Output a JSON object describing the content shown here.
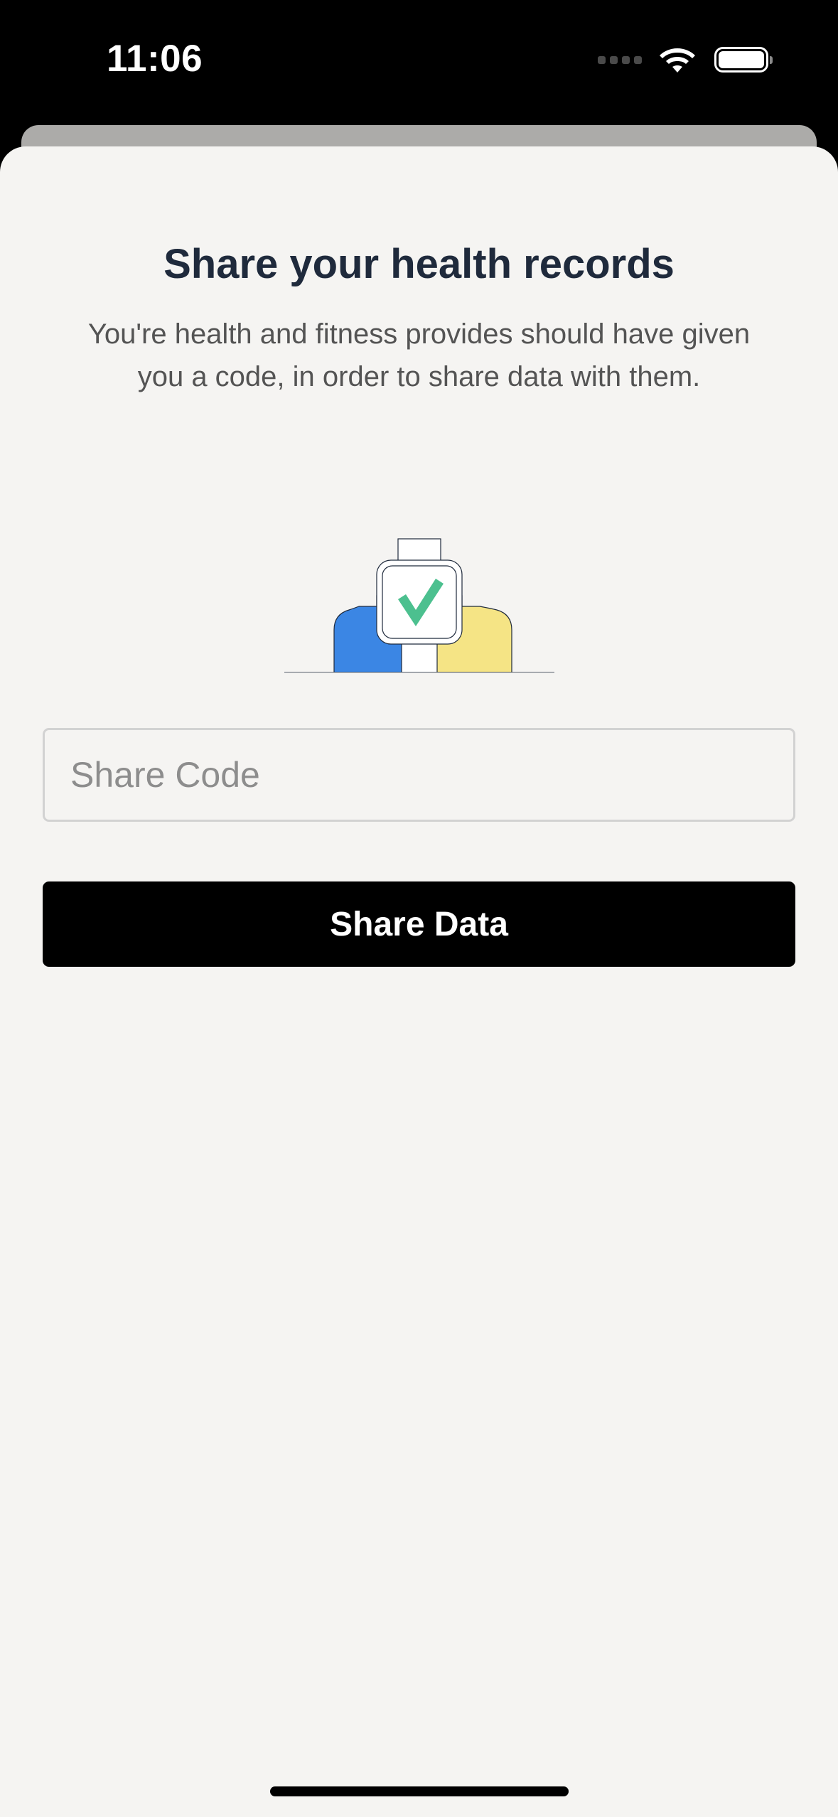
{
  "status_bar": {
    "time": "11:06",
    "icons": [
      "signal-dots-icon",
      "wifi-icon",
      "battery-icon"
    ]
  },
  "main": {
    "title": "Share your health records",
    "subtitle_line1": "You're health and fitness provides should have given",
    "subtitle_line2": "you a code, in order to share data with them.",
    "illustration": "smartwatch-checkmark-icon",
    "share_code": {
      "value": "",
      "placeholder": "Share Code"
    },
    "share_button_label": "Share Data"
  },
  "colors": {
    "title": "#1f2a3c",
    "background": "#f5f4f2",
    "button": "#000000",
    "check": "#4cc08f",
    "blue": "#3b86e4",
    "yellow": "#f5e485"
  }
}
